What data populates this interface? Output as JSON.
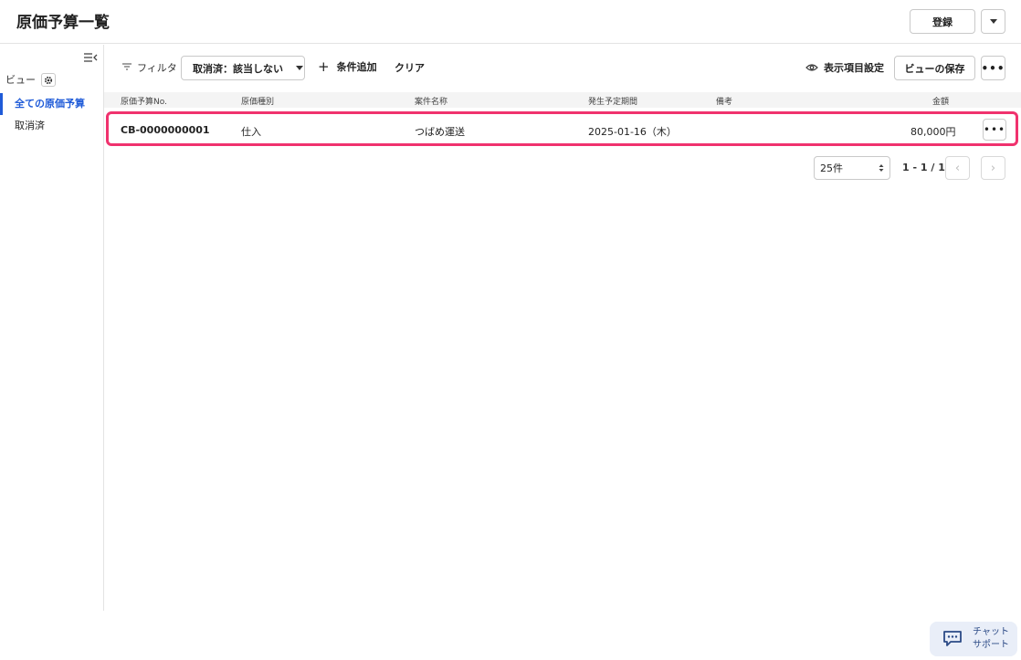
{
  "header": {
    "title": "原価予算一覧",
    "register_label": "登録"
  },
  "sidebar": {
    "view_label": "ビュー",
    "items": [
      {
        "label": "全ての原価予算",
        "active": true
      },
      {
        "label": "取消済",
        "active": false
      }
    ]
  },
  "toolbar": {
    "filter_label": "フィルタ",
    "filter_chip": "取消済：該当しない",
    "add_condition": "条件追加",
    "clear": "クリア",
    "display_settings": "表示項目設定",
    "save_view": "ビューの保存"
  },
  "table": {
    "columns": [
      "原価予算No.",
      "原価種別",
      "案件名称",
      "発生予定期間",
      "備考",
      "金額"
    ],
    "rows": [
      {
        "no": "CB-0000000001",
        "type": "仕入",
        "project": "つばめ運送",
        "period": "2025-01-16（木）",
        "note": "",
        "amount": "80,000円"
      }
    ]
  },
  "pagination": {
    "page_size": "25件",
    "info": "1 - 1 / 1"
  },
  "chat": {
    "line1": "チャット",
    "line2": "サポート"
  },
  "colors": {
    "accent": "#1f5bd8",
    "highlight": "#f0326e"
  }
}
